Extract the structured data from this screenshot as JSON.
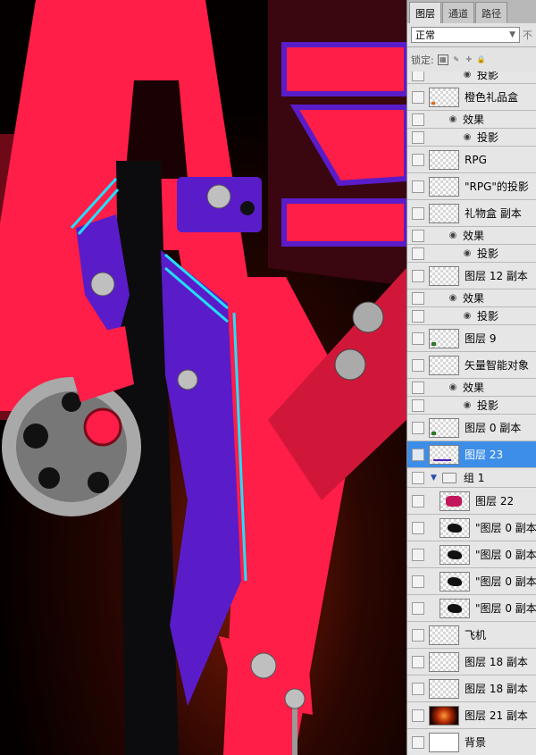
{
  "panel": {
    "tabs": [
      "图层",
      "通道",
      "路径"
    ],
    "active_tab": 0,
    "blend_mode": "正常",
    "opacity_label_partial": "不",
    "lock_label": "锁定:",
    "layers": [
      {
        "kind": "sub2",
        "label": "投影"
      },
      {
        "kind": "layer",
        "label": "橙色礼品盒",
        "thumb": "orange"
      },
      {
        "kind": "sub",
        "label": "效果"
      },
      {
        "kind": "sub2",
        "label": "投影"
      },
      {
        "kind": "layer",
        "label": "RPG",
        "thumb": "check"
      },
      {
        "kind": "layer",
        "label": "\"RPG\"的投影",
        "thumb": "check"
      },
      {
        "kind": "layer",
        "label": "礼物盒 副本",
        "thumb": "check"
      },
      {
        "kind": "sub",
        "label": "效果"
      },
      {
        "kind": "sub2",
        "label": "投影"
      },
      {
        "kind": "layer",
        "label": "图层 12 副本",
        "thumb": "check"
      },
      {
        "kind": "sub",
        "label": "效果"
      },
      {
        "kind": "sub2",
        "label": "投影"
      },
      {
        "kind": "layer",
        "label": "图层 9",
        "thumb": "green"
      },
      {
        "kind": "layer",
        "label": "矢量智能对象",
        "thumb": "check"
      },
      {
        "kind": "sub",
        "label": "效果"
      },
      {
        "kind": "sub2",
        "label": "投影"
      },
      {
        "kind": "layer",
        "label": "图层 0 副本",
        "thumb": "green"
      },
      {
        "kind": "layer",
        "label": "图层 23",
        "thumb": "line",
        "selected": true
      },
      {
        "kind": "group",
        "label": "组 1"
      },
      {
        "kind": "child",
        "label": "图层 22",
        "thumb": "pink"
      },
      {
        "kind": "child",
        "label": "\"图层 0 副本\"",
        "thumb": "crow"
      },
      {
        "kind": "child",
        "label": "\"图层 0 副本\"",
        "thumb": "crow"
      },
      {
        "kind": "child",
        "label": "\"图层 0 副本\"",
        "thumb": "crow"
      },
      {
        "kind": "child",
        "label": "\"图层 0 副本\"",
        "thumb": "crow"
      },
      {
        "kind": "layer",
        "label": "飞机",
        "thumb": "check"
      },
      {
        "kind": "layer",
        "label": "图层 18 副本",
        "thumb": "check"
      },
      {
        "kind": "layer",
        "label": "图层 18 副本",
        "thumb": "check"
      },
      {
        "kind": "layer",
        "label": "图层 21 副本",
        "thumb": "fire"
      },
      {
        "kind": "layer",
        "label": "背景",
        "thumb": "white"
      }
    ]
  },
  "colors": {
    "letter_red": "#ff1e47",
    "purple": "#5a1cc9",
    "cyan": "#22e0ff",
    "selection": "#3d8ee8"
  }
}
